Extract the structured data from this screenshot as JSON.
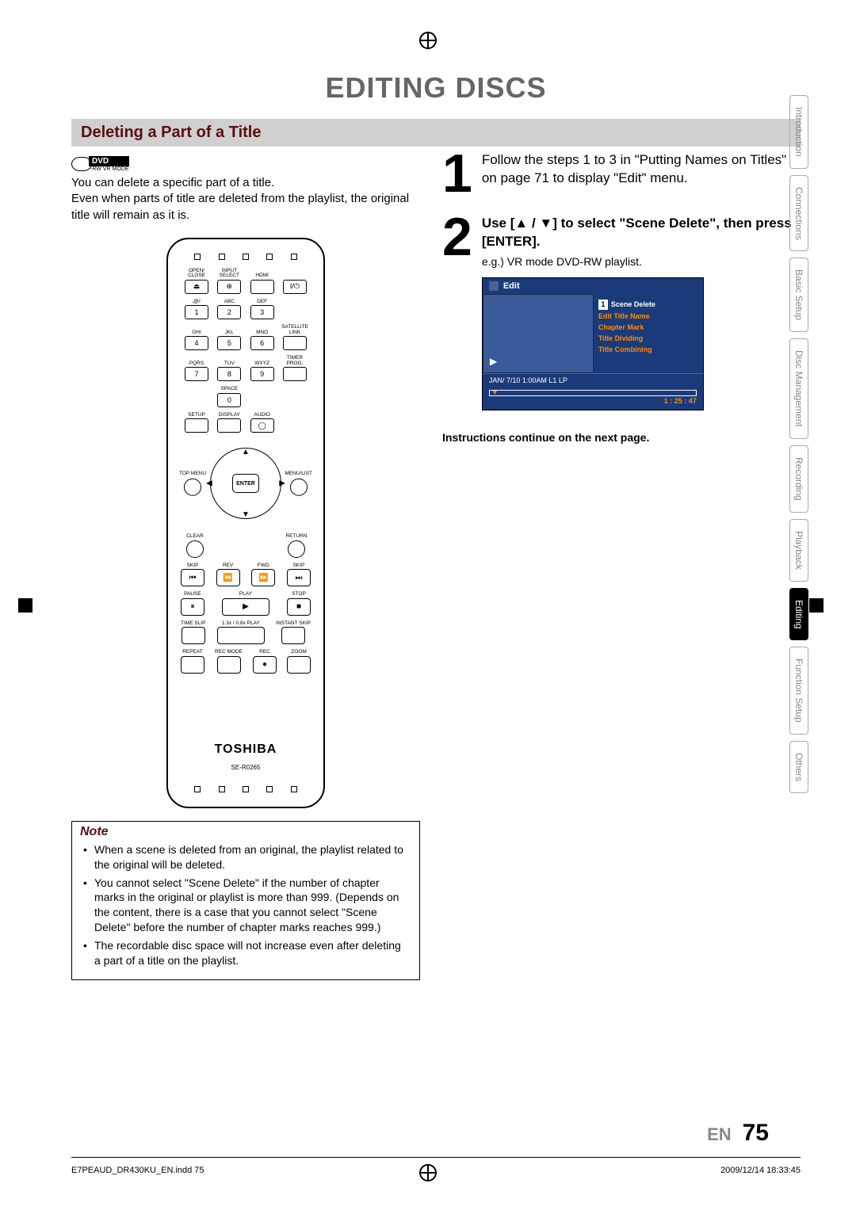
{
  "page_title": "EDITING DISCS",
  "section_title": "Deleting a Part of a Title",
  "dvd_badge": {
    "main": "DVD",
    "sub1": "-RW",
    "sub2": "VR MODE"
  },
  "intro_1": "You can delete a specific part of a title.",
  "intro_2": "Even when parts of title are deleted from the playlist, the original title will remain as it is.",
  "remote": {
    "row1": {
      "a": "OPEN/\nCLOSE",
      "b": "INPUT\nSELECT",
      "c": "HDMI",
      "power": "I/⏻"
    },
    "keypad_labels": [
      "․@/:",
      "ABC",
      "DEF",
      "GHI",
      "JKL",
      "MNO",
      "PQRS",
      "TUV",
      "WXYZ",
      "",
      "SPACE",
      ""
    ],
    "keypad": [
      "1",
      "2",
      "3",
      "4",
      "5",
      "6",
      "7",
      "8",
      "9",
      "",
      "0",
      ""
    ],
    "satellite": "SATELLITE\nLINK",
    "timer": "TIMER\nPROG.",
    "row_sda": [
      "SETUP",
      "DISPLAY",
      "AUDIO"
    ],
    "top_menu": "TOP MENU",
    "menu_list": "MENU/LIST",
    "enter": "ENTER",
    "clear": "CLEAR",
    "return": "RETURN",
    "media_labels": [
      "SKIP",
      "REV",
      "FWD",
      "SKIP",
      "PAUSE",
      "PLAY",
      "STOP"
    ],
    "time_row": [
      "TIME SLIP",
      "1.3x / 0.8x PLAY",
      "INSTANT SKIP"
    ],
    "bottom_row": [
      "REPEAT",
      "REC MODE",
      "REC",
      "ZOOM"
    ],
    "brand": "TOSHIBA",
    "model": "SE-R0265"
  },
  "steps": [
    {
      "n": "1",
      "text": "Follow the steps 1 to 3 in \"Putting Names on Titles\" on page 71 to display \"Edit\" menu."
    },
    {
      "n": "2",
      "text": "Use [▲ / ▼] to select \"Scene Delete\", then press [ENTER].",
      "sub": "e.g.) VR mode DVD-RW playlist."
    }
  ],
  "edit_menu": {
    "header": "Edit",
    "index": "1",
    "items": [
      "Scene Delete",
      "Edit Title Name",
      "Chapter Mark",
      "Title Dividing",
      "Title Combining"
    ],
    "meta": "JAN/ 7/10  1:00AM L1    LP",
    "time": "1 : 25 : 47"
  },
  "continue_note": "Instructions continue on the next page.",
  "note": {
    "title": "Note",
    "items": [
      "When a scene is deleted from an original, the playlist related to the original will be deleted.",
      "You cannot select \"Scene Delete\" if the number of chapter marks in the original or playlist is more than 999. (Depends on the content, there is a case that you cannot select \"Scene Delete\" before the number of chapter marks reaches 999.)",
      "The recordable disc space will not increase even after deleting a part of a title on the playlist."
    ]
  },
  "tabs": [
    "Introduction",
    "Connections",
    "Basic Setup",
    "Disc\nManagement",
    "Recording",
    "Playback",
    "Editing",
    "Function Setup",
    "Others"
  ],
  "active_tab_index": 6,
  "page_lang": "EN",
  "page_number": "75",
  "footer_left": "E7PEAUD_DR430KU_EN.indd   75",
  "footer_right": "2009/12/14   18:33:45"
}
